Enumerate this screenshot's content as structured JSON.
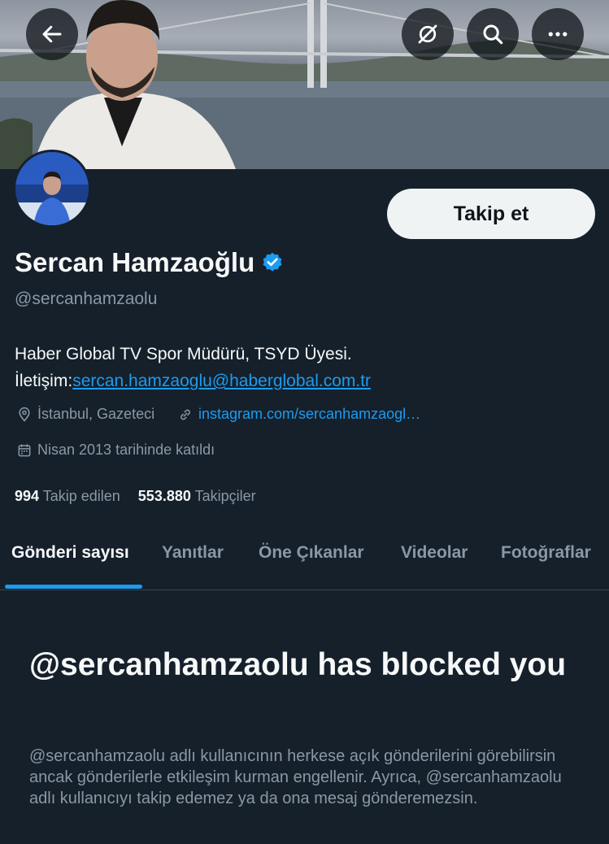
{
  "header": {
    "back_icon": "arrow-left-icon",
    "mute_icon": "slashed-circle-icon",
    "search_icon": "search-icon",
    "more_icon": "ellipsis-icon"
  },
  "profile": {
    "name": "Sercan Hamzaoğlu",
    "verified": true,
    "handle": "@sercanhamzaolu",
    "follow_label": "Takip et",
    "bio_line1": "Haber Global TV Spor Müdürü, TSYD Üyesi.",
    "bio_contact_prefix": "İletişim:",
    "bio_email": "sercan.hamzaoglu@haberglobal.com.tr",
    "location": "İstanbul, Gazeteci",
    "website": "instagram.com/sercanhamzaogl…",
    "joined": "Nisan 2013 tarihinde katıldı",
    "following_count": "994",
    "following_label": "Takip edilen",
    "followers_count": "553.880",
    "followers_label": "Takipçiler"
  },
  "tabs": [
    {
      "label": "Gönderi sayısı",
      "active": true
    },
    {
      "label": "Yanıtlar",
      "active": false
    },
    {
      "label": "Öne Çıkanlar",
      "active": false
    },
    {
      "label": "Videolar",
      "active": false
    },
    {
      "label": "Fotoğraflar",
      "active": false
    }
  ],
  "blocked": {
    "title": "@sercanhamzaolu has blocked you",
    "message": "@sercanhamzaolu adlı kullanıcının herkese açık gönderilerini görebilirsin ancak gönderilerle etkileşim kurman engellenir. Ayrıca, @sercanhamzaolu adlı kullanıcıyı takip edemez ya da ona mesaj gönderemezsin."
  },
  "colors": {
    "background": "#15202b",
    "accent": "#1d9bf0",
    "text_primary": "#f7f9f9",
    "text_secondary": "#8b98a5"
  }
}
